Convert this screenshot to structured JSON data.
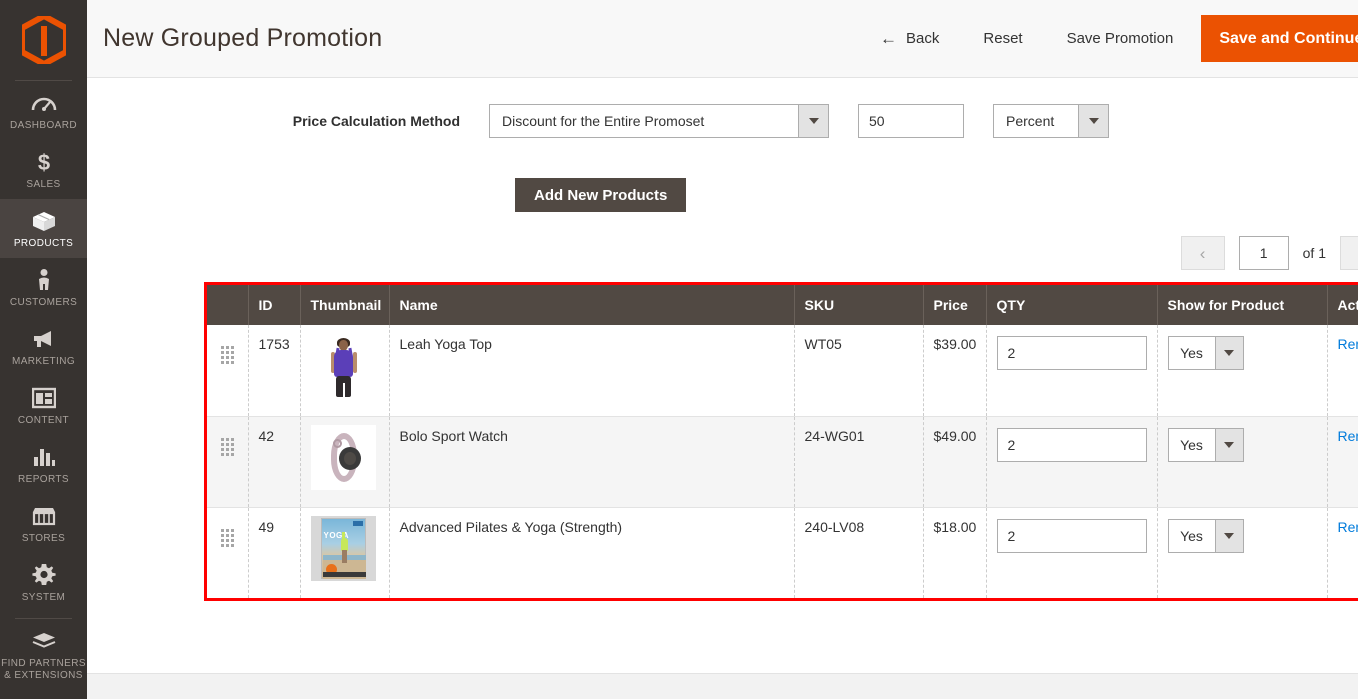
{
  "app": {
    "logo_name": "magento-logo"
  },
  "sidebar": {
    "items": [
      {
        "label": "DASHBOARD",
        "icon": "dashboard-icon",
        "active": false
      },
      {
        "label": "SALES",
        "icon": "dollar-icon",
        "active": false
      },
      {
        "label": "PRODUCTS",
        "icon": "box-icon",
        "active": true
      },
      {
        "label": "CUSTOMERS",
        "icon": "person-icon",
        "active": false
      },
      {
        "label": "MARKETING",
        "icon": "megaphone-icon",
        "active": false
      },
      {
        "label": "CONTENT",
        "icon": "layout-icon",
        "active": false
      },
      {
        "label": "REPORTS",
        "icon": "bar-chart-icon",
        "active": false
      },
      {
        "label": "STORES",
        "icon": "storefront-icon",
        "active": false
      },
      {
        "label": "SYSTEM",
        "icon": "gear-icon",
        "active": false
      },
      {
        "label": "FIND PARTNERS\n& EXTENSIONS",
        "icon": "extensions-icon",
        "active": false
      }
    ]
  },
  "header": {
    "title": "New Grouped Promotion",
    "back_label": "Back",
    "back_arrow": "←",
    "reset_label": "Reset",
    "save_label": "Save Promotion",
    "save_continue_label": "Save and Continue Edit",
    "primary_color": "#eb5202"
  },
  "form": {
    "price_calculation_label": "Price Calculation Method",
    "method_value": "Discount for the Entire Promoset",
    "amount_value": "50",
    "unit_value": "Percent"
  },
  "actions": {
    "add_new_products_label": "Add New Products"
  },
  "pager": {
    "prev_icon": "‹",
    "page_value": "1",
    "of_label": "of 1",
    "next_icon": "›"
  },
  "grid": {
    "highlight_color": "#ff0000",
    "columns": [
      "",
      "ID",
      "Thumbnail",
      "Name",
      "SKU",
      "Price",
      "QTY",
      "Show for Product",
      "Actions"
    ],
    "remove_label": "Remove",
    "rows": [
      {
        "id": "1753",
        "thumbnail": "leah-yoga-top-thumbnail",
        "name": "Leah Yoga Top",
        "sku": "WT05",
        "price": "$39.00",
        "qty": "2",
        "show_for_product": "Yes",
        "action": "Remove"
      },
      {
        "id": "42",
        "thumbnail": "bolo-sport-watch-thumbnail",
        "name": "Bolo Sport Watch",
        "sku": "24-WG01",
        "price": "$49.00",
        "qty": "2",
        "show_for_product": "Yes",
        "action": "Remove"
      },
      {
        "id": "49",
        "thumbnail": "advanced-pilates-yoga-thumbnail",
        "name": "Advanced Pilates & Yoga (Strength)",
        "sku": "240-LV08",
        "price": "$18.00",
        "qty": "2",
        "show_for_product": "Yes",
        "action": "Remove"
      }
    ]
  }
}
